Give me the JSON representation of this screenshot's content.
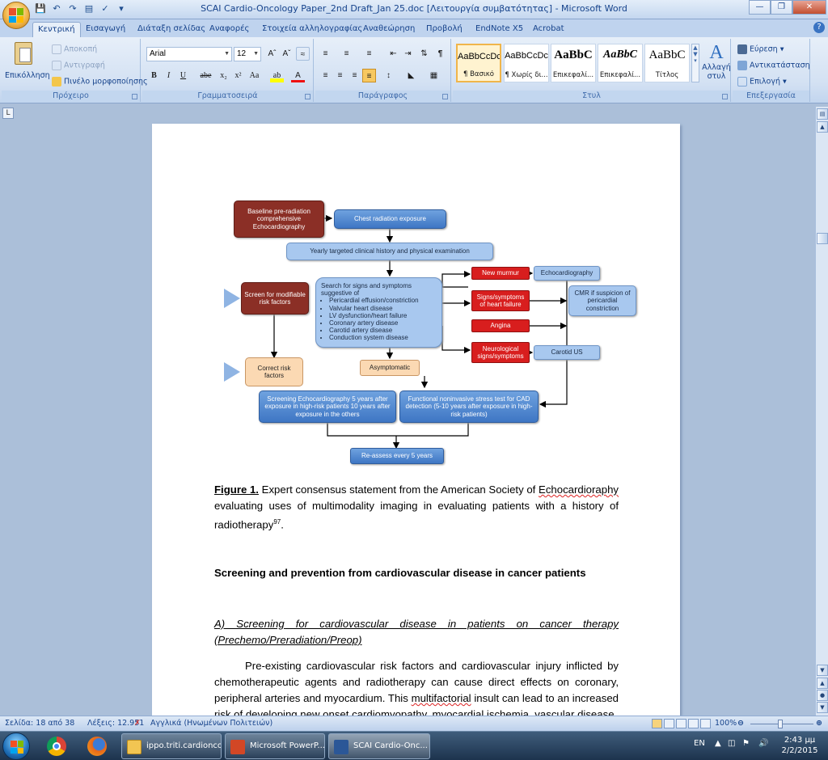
{
  "window": {
    "title": "SCAI Cardio-Oncology Paper_2nd Draft_Jan 25.doc [Λειτουργία συμβατότητας] - Microsoft Word"
  },
  "tabs": [
    "Κεντρική",
    "Εισαγωγή",
    "Διάταξη σελίδας",
    "Αναφορές",
    "Στοιχεία αλληλογραφίας",
    "Αναθεώρηση",
    "Προβολή",
    "EndNote X5",
    "Acrobat"
  ],
  "ribbon": {
    "clipboard": {
      "paste": "Επικόλληση",
      "cut": "Αποκοπή",
      "copy": "Αντιγραφή",
      "format_painter": "Πινέλο μορφοποίησης",
      "label": "Πρόχειρο"
    },
    "font": {
      "name": "Arial",
      "size": "12",
      "label": "Γραμματοσειρά"
    },
    "paragraph": {
      "label": "Παράγραφος"
    },
    "styles": {
      "label": "Στυλ",
      "cards": [
        {
          "preview": "AaBbCcDc",
          "name": "¶ Βασικό"
        },
        {
          "preview": "AaBbCcDc",
          "name": "¶ Χωρίς δι..."
        },
        {
          "preview": "AaBbC",
          "name": "Επικεφαλί..."
        },
        {
          "preview": "AaBbC",
          "name": "Επικεφαλί..."
        },
        {
          "preview": "AaBbC",
          "name": "Τίτλος"
        }
      ],
      "change_styles_1": "Αλλαγή",
      "change_styles_2": "στυλ"
    },
    "editing": {
      "find": "Εύρεση",
      "replace": "Αντικατάσταση",
      "select": "Επιλογή",
      "label": "Επεξεργασία"
    }
  },
  "flowchart": {
    "baseline": "Baseline pre-radiation comprehensive Echocardiography",
    "chest_rad": "Chest radiation exposure",
    "yearly": "Yearly targeted clinical history and physical examination",
    "screen_risk": "Screen for modifiable risk factors",
    "search_title": "Search for signs and symptoms suggestive of",
    "search_items": [
      "Pericardial effusion/constriction",
      "Valvular heart disease",
      "LV dysfunction/heart failure",
      "Coronary artery disease",
      "Carotid artery disease",
      "Conduction system disease"
    ],
    "new_murmur": "New murmur",
    "signs_hf": "Signs/symptoms of heart failure",
    "angina": "Angina",
    "neuro": "Neurological signs/symptoms",
    "echo": "Echocardiography",
    "cmr": "CMR if suspicion of pericardial constriction",
    "carotid": "Carotid US",
    "correct_risk": "Correct risk factors",
    "asymptomatic": "Asymptomatic",
    "screening_echo": "Screening Echocardiography 5 years after exposure in high-risk patients 10 years after exposure in the others",
    "functional": "Functional noninvasive stress test for CAD detection (5-10 years after exposure in high-risk patients)",
    "reassess": "Re-assess every 5 years"
  },
  "document": {
    "figure_label": "Figure 1.",
    "caption_1": " Expert consensus statement from the American Society of ",
    "caption_err": "Echocardioraphy",
    "caption_2": " evaluating uses of multimodality imaging in evaluating patients with a history of radiotherapy",
    "caption_ref": "97",
    "caption_end": ".",
    "heading": "Screening and prevention from cardiovascular disease in cancer patients",
    "subheading_1": "A) Screening for cardiovascular disease in patients on cancer therapy",
    "subheading_2": "(Prechemo/Preradiation/Preop)",
    "para_1": "Pre-existing cardiovascular risk factors and cardiovascular injury inflicted by chemotherapeutic agents and radiotherapy can cause direct effects on coronary, peripheral arteries and myocardium. This ",
    "para_err": "multifactorial",
    "para_2": " insult can lead to an increased risk of developing new onset cardiomyopathy, myocardial ischemia, vascular disease"
  },
  "statusbar": {
    "page": "Σελίδα: 18 από 38",
    "words": "Λέξεις: 12.951",
    "language": "Αγγλικά (Ηνωμένων Πολιτειών)",
    "zoom": "100%"
  },
  "taskbar": {
    "tasks": [
      "ippo.triti.cardionco",
      "Microsoft PowerP...",
      "SCAI Cardio-Onc..."
    ],
    "lang": "EN",
    "time": "2:43 μμ",
    "date": "2/2/2015"
  }
}
